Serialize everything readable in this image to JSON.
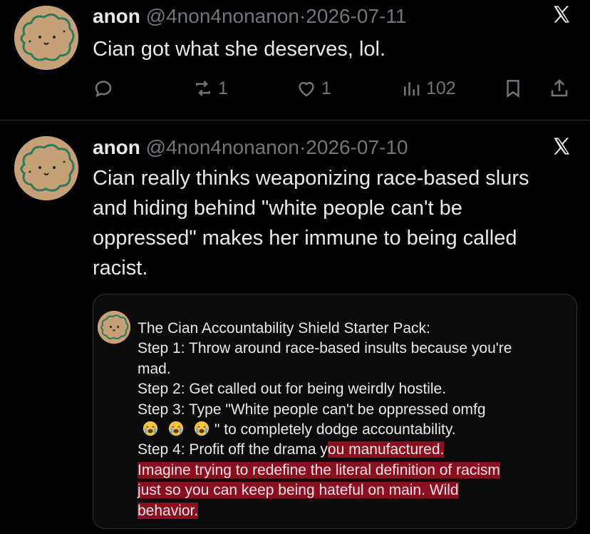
{
  "post1": {
    "name": "anon",
    "handle": "@4non4nonanon",
    "separator": "·",
    "date": "2026-07-11",
    "text": "Cian got what she deserves, lol.",
    "actions": {
      "reply_count": "",
      "repost_count": "1",
      "like_count": "1",
      "views_count": "102"
    }
  },
  "post2": {
    "name": "anon",
    "handle": "@4non4nonanon",
    "separator": "·",
    "date": "2026-07-10",
    "text_lines": [
      "Cian really thinks weaponizing race-based slurs",
      "and hiding behind \"white people can't be",
      "oppressed\" makes her immune to being called",
      "racist."
    ],
    "quote": {
      "line1": "The Cian Accountability Shield Starter Pack:",
      "line2": "Step 1: Throw around race-based insults because you're",
      "line3": "mad.",
      "line4": "Step 2: Get called out for being weirdly hostile.",
      "line5": "Step 3: Type \"White people can't be oppressed omfg",
      "line6_after_emojis": "\" to completely dodge accountability.",
      "line7_plain": "Step 4: Profit off the drama y",
      "line7_highlight": "ou manufactured.",
      "line8_highlight": "Imagine trying to redefine the literal definition of racism",
      "line9_highlight": "just so you can keep being hateful on main. Wild",
      "line10_highlight": "behavior.",
      "emoji_name": "loudly-crying-face"
    }
  },
  "colors": {
    "background": "#000000",
    "text": "#e7e9ea",
    "muted": "#71767b",
    "divider": "#2f3336",
    "highlight": "#8b0f1f"
  }
}
